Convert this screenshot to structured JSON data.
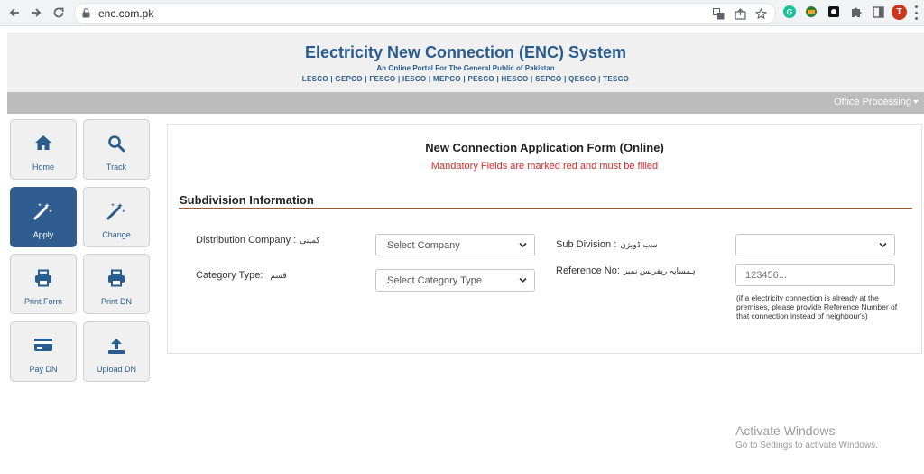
{
  "browser": {
    "url": "enc.com.pk",
    "profile_initial": "T"
  },
  "header": {
    "title": "Electricity New Connection (ENC) System",
    "subtitle": "An Online Portal For The General Public of Pakistan",
    "companies": "LESCO | GEPCO | FESCO | IESCO | MEPCO | PESCO | HESCO | SEPCO | QESCO | TESCO"
  },
  "menubar": {
    "office_processing": "Office Processing"
  },
  "sidebar": {
    "items": [
      {
        "label": "Home",
        "icon": "home-icon"
      },
      {
        "label": "Track",
        "icon": "search-icon"
      },
      {
        "label": "Apply",
        "icon": "magic-wand-icon"
      },
      {
        "label": "Change",
        "icon": "magic-wand-icon"
      },
      {
        "label": "Print Form",
        "icon": "printer-icon"
      },
      {
        "label": "Print DN",
        "icon": "printer-icon"
      },
      {
        "label": "Pay DN",
        "icon": "credit-card-icon"
      },
      {
        "label": "Upload DN",
        "icon": "upload-icon"
      }
    ],
    "active": "Apply"
  },
  "form": {
    "title": "New Connection Application Form (Online)",
    "note": "Mandatory Fields are marked red and must be filled",
    "section": "Subdivision Information",
    "distribution_company_label": "Distribution Company :",
    "distribution_company_urdu": "کمپنی",
    "distribution_company_value": "Select Company",
    "category_type_label": "Category Type:",
    "category_type_urdu": "قسم",
    "category_type_value": "Select Category Type",
    "sub_division_label": "Sub Division :",
    "sub_division_urdu": "سب ڈویژن",
    "sub_division_value": "",
    "reference_no_label": "Reference No:",
    "reference_no_urdu": "ہمسایہ ریفرنس نمبر",
    "reference_no_placeholder": "123456...",
    "reference_help": "(if a electricity connection is already at the premises, please provide Reference Number of that connection instead of neighbour's)"
  },
  "watermark": {
    "title": "Activate Windows",
    "subtitle": "Go to Settings to activate Windows."
  },
  "colors": {
    "brand_blue": "#2a5d8f",
    "active_tile": "#2f5d8f",
    "mandatory_red": "#d62b2b",
    "section_rule": "#a35a2a"
  }
}
